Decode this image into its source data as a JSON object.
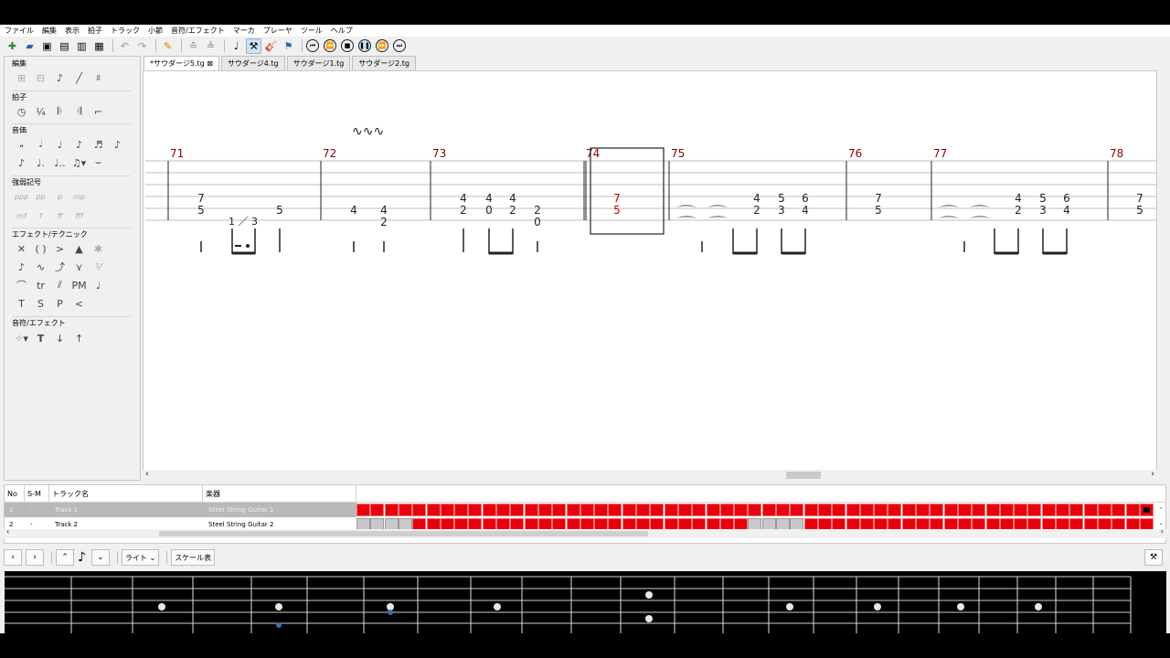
{
  "menu": [
    "ファイル",
    "編集",
    "表示",
    "拍子",
    "トラック",
    "小節",
    "音符/エフェクト",
    "マーカ",
    "プレーヤ",
    "ツール",
    "ヘルプ"
  ],
  "palette": {
    "sections": [
      "編集",
      "拍子",
      "音価",
      "強弱記号",
      "エフェクト/テクニック",
      "音符/エフェクト"
    ],
    "dynamics_row1": [
      "ppp",
      "pp",
      "p",
      "mp"
    ],
    "dynamics_row2": [
      "mf",
      "f",
      "ff",
      "fff"
    ],
    "effect_labels": [
      "tr",
      "PM",
      "T",
      "S",
      "P"
    ]
  },
  "tabs": [
    "*サウダージ5.tg",
    "サウダージ4.tg",
    "サウダージ1.tg",
    "サウダージ2.tg"
  ],
  "score": {
    "measure_numbers": [
      "71",
      "72",
      "73",
      "74",
      "75",
      "76",
      "77",
      "78"
    ],
    "tuplet": "1 ／ 3",
    "tab_notes": [
      [
        "7",
        "5",
        "5"
      ],
      [
        "4",
        "4",
        "2"
      ],
      [
        "4",
        "4",
        "4",
        "2",
        "0",
        "2",
        "2",
        "0"
      ],
      [
        "7",
        "5"
      ],
      [
        "4",
        "5",
        "6",
        "2",
        "3",
        "4"
      ],
      [
        "7",
        "5"
      ],
      [
        "4",
        "5",
        "6",
        "2",
        "3",
        "4"
      ],
      [
        "7",
        "5"
      ]
    ]
  },
  "tracks": {
    "headers": [
      "No",
      "S-M",
      "トラック名",
      "楽器"
    ],
    "rows": [
      {
        "no": "1",
        "sm": "-",
        "name": "Track 1",
        "instrument": "Steel String Guitar 1"
      },
      {
        "no": "2",
        "sm": "-",
        "name": "Track 2",
        "instrument": "Steel String Guitar 2"
      }
    ],
    "accent": "#e8000d"
  },
  "fretboard_bar": {
    "hand_select": "ライト",
    "scale_button": "スケール表"
  }
}
